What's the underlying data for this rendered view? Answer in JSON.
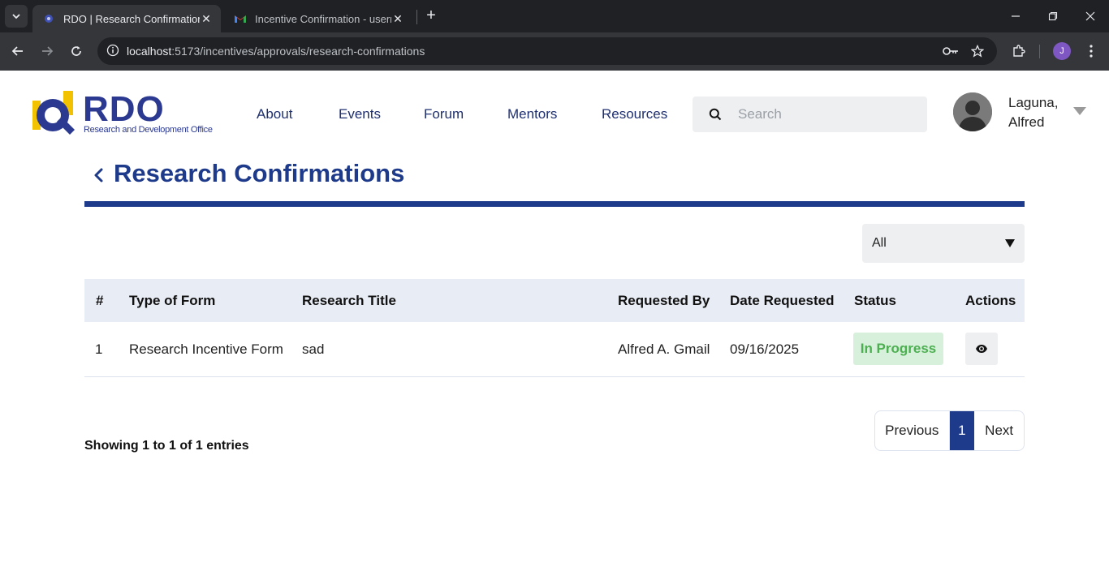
{
  "browser": {
    "tabs": [
      {
        "title": "RDO | Research Confirmation",
        "active": true,
        "favicon": "rdo-favicon"
      },
      {
        "title": "Incentive Confirmation - usernu",
        "active": false,
        "favicon": "gmail-icon"
      }
    ],
    "url_host": "localhost",
    "url_path": ":5173/incentives/approvals/research-confirmations",
    "profile_initial": "J"
  },
  "header": {
    "logo_word": "RDO",
    "logo_subtitle": "Research and Development Office",
    "nav": [
      "About",
      "Events",
      "Forum",
      "Mentors",
      "Resources"
    ],
    "search_placeholder": "Search",
    "user_line1": "Laguna,",
    "user_line2": "Alfred"
  },
  "page": {
    "title": "Research Confirmations",
    "filter_value": "All"
  },
  "table": {
    "columns": [
      "#",
      "Type of Form",
      "Research Title",
      "Requested By",
      "Date Requested",
      "Status",
      "Actions"
    ],
    "rows": [
      {
        "num": "1",
        "type": "Research Incentive Form",
        "title": "sad",
        "requested_by": "Alfred A. Gmail",
        "date": "09/16/2025",
        "status": "In Progress"
      }
    ]
  },
  "footer": {
    "showing": "Showing 1 to 1 of 1 entries",
    "prev": "Previous",
    "current": "1",
    "next": "Next"
  },
  "colors": {
    "brand": "#1e3a8a",
    "status_green": "#4caf50",
    "status_bg": "#d7f0dc"
  }
}
